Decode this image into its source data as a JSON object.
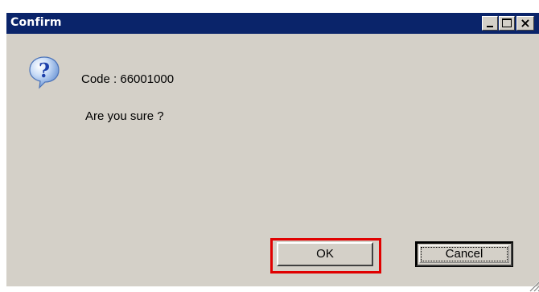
{
  "window": {
    "title": "Confirm",
    "controls": {
      "minimize": "minimize",
      "maximize": "maximize",
      "close": "×"
    }
  },
  "message": {
    "icon": "question-icon",
    "code": "Code : 66001000",
    "text": "Are you sure ?"
  },
  "buttons": {
    "ok_label": "OK",
    "cancel_label": "Cancel"
  },
  "colors": {
    "titlebar": "#0a246a",
    "window_bg": "#d4d0c8",
    "highlight": "#e00000",
    "icon_blue": "#1c5bd1"
  }
}
